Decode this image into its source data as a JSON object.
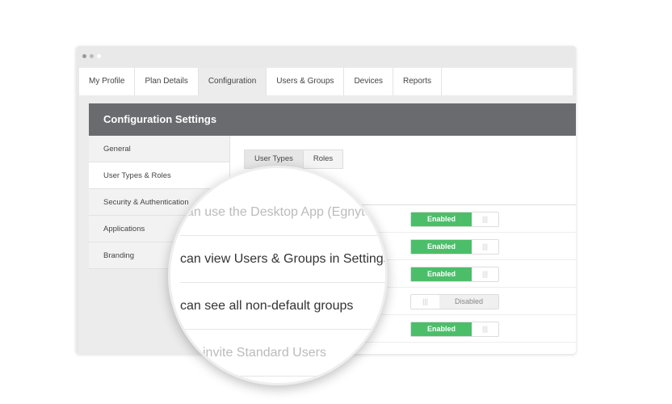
{
  "tabs": [
    "My Profile",
    "Plan Details",
    "Configuration",
    "Users & Groups",
    "Devices",
    "Reports"
  ],
  "header": {
    "title": "Configuration Settings"
  },
  "sidebar": [
    "General",
    "User Types & Roles",
    "Security & Authentication",
    "Applications",
    "Branding"
  ],
  "subtabs": [
    "User Types",
    "Roles"
  ],
  "toggles": [
    {
      "state": "Enabled"
    },
    {
      "state": "Enabled"
    },
    {
      "state": "Enabled"
    },
    {
      "state": "Disabled"
    },
    {
      "state": "Enabled"
    }
  ],
  "magnifier": [
    "can use the Desktop App (Egnyte)",
    "can view Users & Groups in Settings",
    "can see all non-default groups",
    "invite Standard Users"
  ],
  "colors": {
    "enabled": "#4cbe6a",
    "header": "#6a6b6f"
  }
}
